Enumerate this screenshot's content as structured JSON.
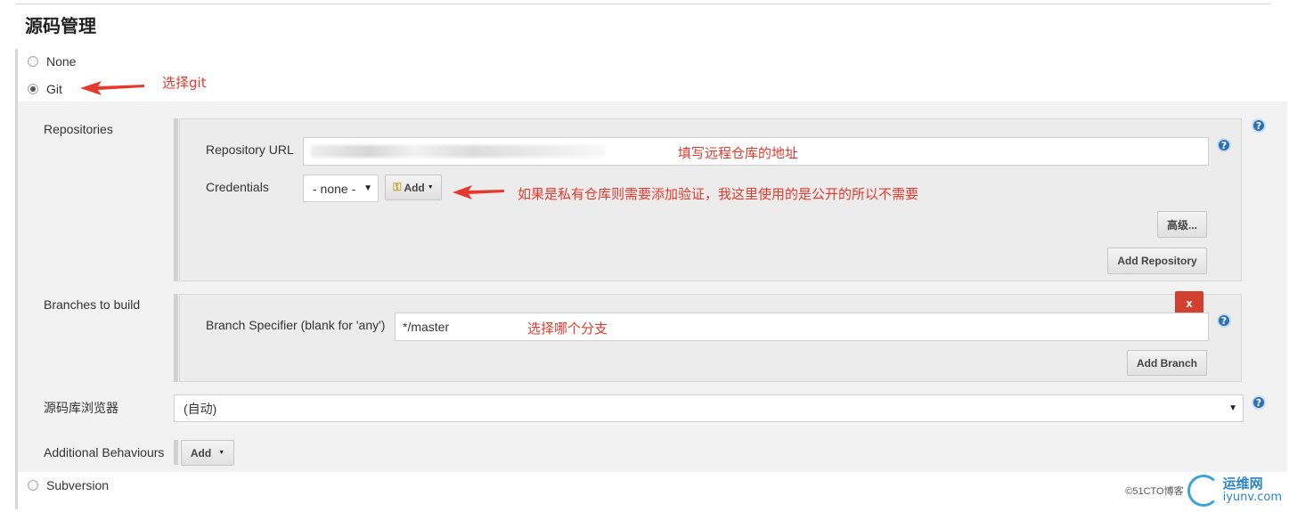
{
  "section": {
    "title": "源码管理"
  },
  "scm_options": {
    "none_label": "None",
    "git_label": "Git",
    "subversion_label": "Subversion",
    "selected": "Git"
  },
  "repositories": {
    "label": "Repositories",
    "url_label": "Repository URL",
    "url_value": "",
    "credentials_label": "Credentials",
    "credentials_selected": "- none -",
    "credentials_add_label": "Add",
    "advanced_button": "高级...",
    "add_repository_button": "Add Repository"
  },
  "branches": {
    "label": "Branches to build",
    "specifier_label": "Branch Specifier (blank for 'any')",
    "specifier_value": "*/master",
    "delete_label": "x",
    "add_branch_button": "Add Branch"
  },
  "browser": {
    "label": "源码库浏览器",
    "selected": "(自动)"
  },
  "additional": {
    "label": "Additional Behaviours",
    "add_label": "Add"
  },
  "help_glyph": "?",
  "annotations": {
    "git": "选择git",
    "url": "填写远程仓库的地址",
    "credentials": "如果是私有仓库则需要添加验证，我这里使用的是公开的所以不需要",
    "branch": "选择哪个分支"
  },
  "watermark": {
    "cn": "运维网",
    "en": "iyunv.com",
    "prefix": "©51CTO博客"
  },
  "colors": {
    "annotation": "#e33b2d",
    "help": "#2f6fb3",
    "delete": "#d1402f"
  }
}
